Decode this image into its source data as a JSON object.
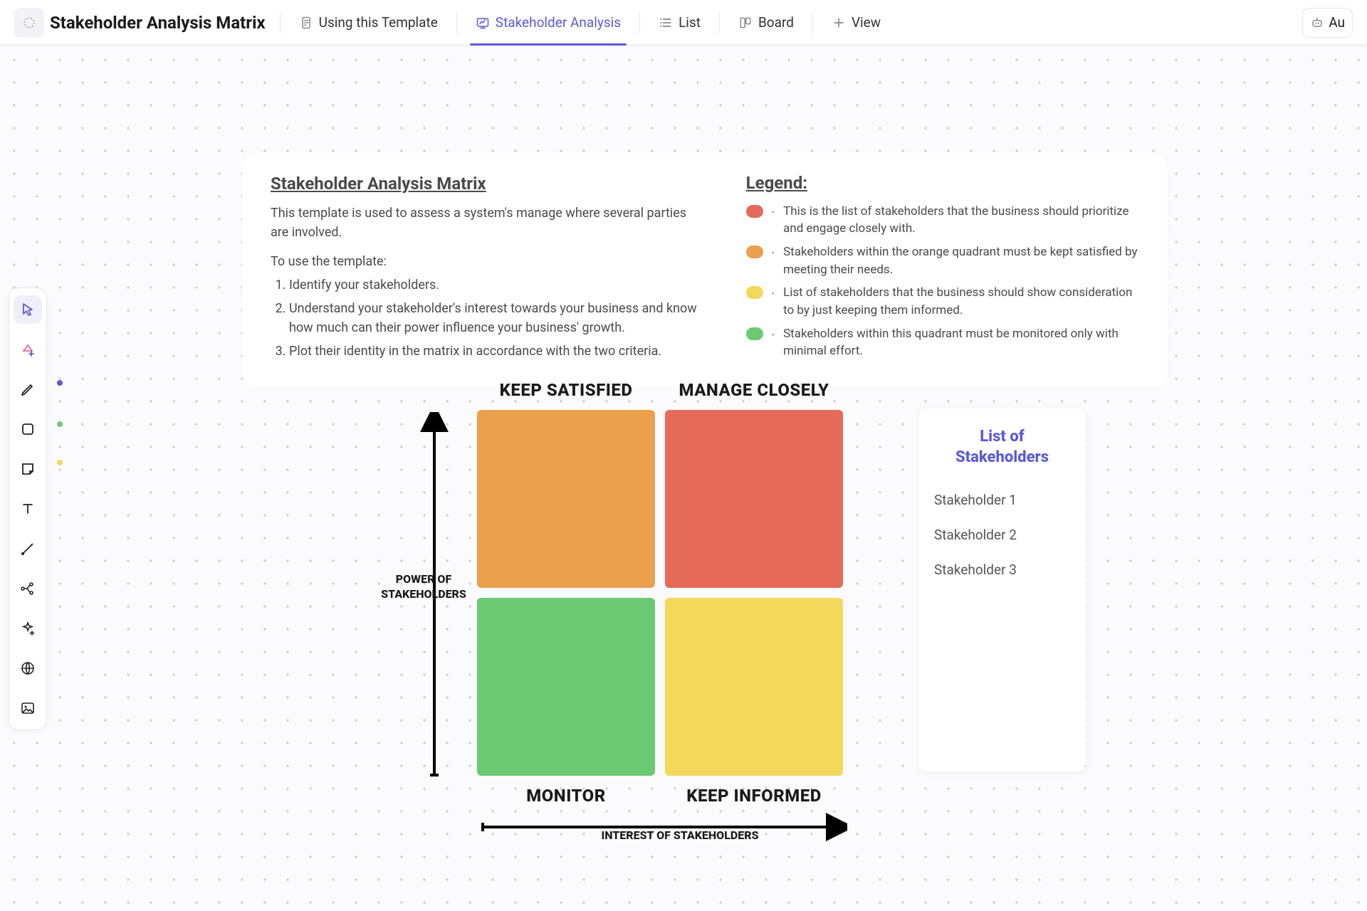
{
  "header": {
    "title": "Stakeholder Analysis Matrix",
    "tabs": [
      {
        "label": "Using this Template",
        "icon": "doc-icon"
      },
      {
        "label": "Stakeholder Analysis",
        "icon": "whiteboard-icon",
        "active": true
      },
      {
        "label": "List",
        "icon": "list-icon"
      },
      {
        "label": "Board",
        "icon": "board-icon"
      }
    ],
    "add_view": "View",
    "automation_label": "Au"
  },
  "info_card": {
    "title": "Stakeholder Analysis Matrix",
    "subtitle": "This template is used to assess a system's manage where several parties are involved.",
    "instructions_header": "To use the template:",
    "steps": [
      "Identify your stakeholders.",
      "Understand your stakeholder's interest towards your business and know how much can their power influence your business' growth.",
      "Plot their identity in the matrix in accordance with the two criteria."
    ]
  },
  "legend": {
    "title": "Legend:",
    "items": [
      {
        "color": "red",
        "text": "This is the list of stakeholders that the business should prioritize and engage closely with."
      },
      {
        "color": "orange",
        "text": "Stakeholders within the orange quadrant must be kept satisfied by meeting their needs."
      },
      {
        "color": "yellow",
        "text": "List of stakeholders that the business should show consideration to by just keeping them informed."
      },
      {
        "color": "green",
        "text": "Stakeholders within this quadrant must be monitored only with minimal effort."
      }
    ]
  },
  "matrix": {
    "top_left": "KEEP SATISFIED",
    "top_right": "MANAGE CLOSELY",
    "bottom_left": "MONITOR",
    "bottom_right": "KEEP INFORMED",
    "y_axis": "POWER OF STAKEHOLDERS",
    "x_axis": "INTEREST OF STAKEHOLDERS",
    "colors": {
      "keep_satisfied": "#eaa04c",
      "manage_closely": "#e66a5a",
      "monitor": "#6cc973",
      "keep_informed": "#f2d85b"
    }
  },
  "stakeholders": {
    "title": "List of Stakeholders",
    "items": [
      "Stakeholder 1",
      "Stakeholder 2",
      "Stakeholder 3"
    ]
  },
  "toolbar": {
    "tools": [
      {
        "name": "cursor-icon",
        "selected": true
      },
      {
        "name": "shapes-plus-icon"
      },
      {
        "name": "pen-icon"
      },
      {
        "name": "square-icon"
      },
      {
        "name": "sticky-note-icon"
      },
      {
        "name": "text-icon"
      },
      {
        "name": "connector-icon"
      },
      {
        "name": "mindmap-icon"
      },
      {
        "name": "sparkle-icon"
      },
      {
        "name": "web-icon"
      },
      {
        "name": "image-icon"
      }
    ]
  }
}
